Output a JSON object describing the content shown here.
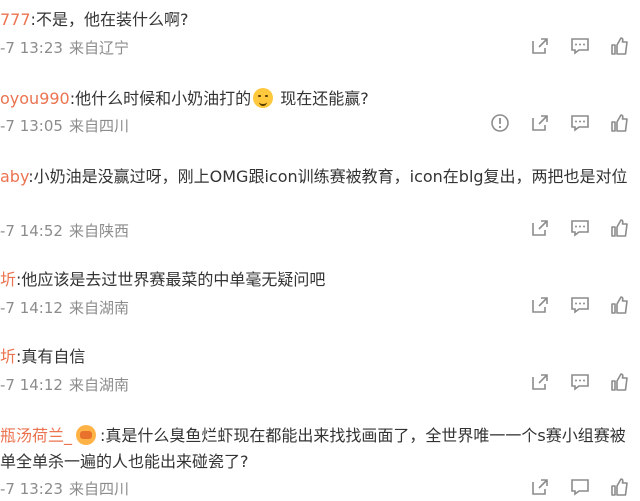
{
  "comments": [
    {
      "user": "777",
      "text": "不是，他在装什么啊?",
      "time": "-7 13:23",
      "location": "来自辽宁",
      "report": false
    },
    {
      "user": "oyou990",
      "text_before": "他什么时候和小奶油打的",
      "emoji": "face-emoji",
      "text_after": " 现在还能赢?",
      "time": "-7 13:05",
      "location": "来自四川",
      "report": true
    },
    {
      "user": "aby",
      "text": "小奶油是没赢过呀，刚上OMG跟icon训练赛被教育，icon在blg复出，两把也是对位",
      "time": "-7 14:52",
      "location": "来自陕西",
      "report": false
    },
    {
      "user": "圻",
      "text": "他应该是去过世界赛最菜的中单毫无疑问吧",
      "time": "-7 14:12",
      "location": "来自湖南",
      "report": false
    },
    {
      "user": "圻",
      "text": "真有自信",
      "time": "-7 14:12",
      "location": "来自湖南",
      "report": false
    },
    {
      "user": "瓶汤荷兰_",
      "badge": "vip-badge-icon",
      "line1": ":真是什么臭鱼烂虾现在都能出来找找画面了，全世界唯一一个s赛小组赛被",
      "line2": "单全单杀一遍的人也能出来碰瓷了?",
      "time": "-7 13:23",
      "location": "来自四川",
      "report": false
    }
  ],
  "colors": {
    "username": "#eb7350",
    "meta": "#8c8c8c",
    "icon": "#8c8c8c"
  },
  "icons": [
    "report-icon",
    "share-icon",
    "comment-icon",
    "like-icon"
  ]
}
